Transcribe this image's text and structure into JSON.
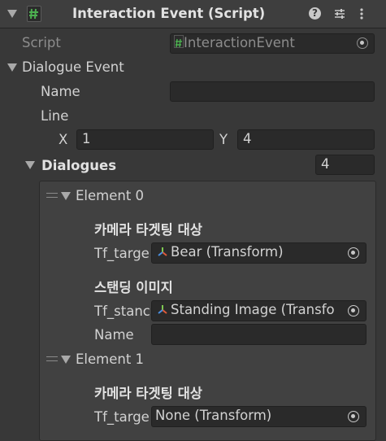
{
  "header": {
    "title": "Interaction Event (Script)",
    "script_icon": "hash-icon",
    "help_icon": "help-icon",
    "preset_icon": "sliders-icon",
    "menu_icon": "kebab-menu-icon"
  },
  "script_row": {
    "label": "Script",
    "value": "InteractionEvent"
  },
  "dialogue_event": {
    "label": "Dialogue Event",
    "name_label": "Name",
    "name_value": "",
    "line_label": "Line",
    "x_label": "X",
    "x_value": "1",
    "y_label": "Y",
    "y_value": "4",
    "dialogues_label": "Dialogues",
    "dialogues_count": "4"
  },
  "elements": [
    {
      "label": "Element 0",
      "camera_header": "카메라 타겟팅 대상",
      "tf_target_label": "Tf_targe",
      "tf_target_value": "Bear (Transform)",
      "standing_header": "스탠딩 이미지",
      "tf_standing_label": "Tf_stanc",
      "tf_standing_value": "Standing Image (Transfo",
      "name_label": "Name",
      "name_value": ""
    },
    {
      "label": "Element 1",
      "camera_header": "카메라 타겟팅 대상",
      "tf_target_label": "Tf_targe",
      "tf_target_value": "None (Transform)"
    }
  ],
  "colors": {
    "background": "#383838",
    "field": "#2a2a2a",
    "script_icon_green": "#4caf50",
    "transform_red": "#e05a3a",
    "transform_green": "#7ec850",
    "transform_blue": "#4a90e2"
  }
}
